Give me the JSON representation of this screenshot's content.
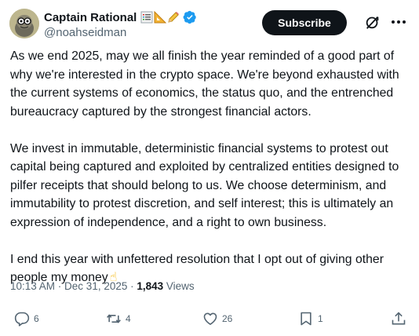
{
  "author": {
    "display_name": "Captain Rational",
    "handle": "@noahseidman",
    "badges": [
      "chart-icon",
      "triangular-ruler-icon",
      "pencil-icon"
    ],
    "verified": true
  },
  "header": {
    "subscribe_label": "Subscribe",
    "grok_icon": "grok-icon",
    "more_icon": "more-icon"
  },
  "post": {
    "paragraphs": [
      "As we end 2025, may we all finish the year reminded of a good part of why we're interested in the crypto space. We're beyond exhausted with the current systems of economics, the status quo, and the entrenched bureaucracy captured by the strongest financial actors.",
      "We invest in immutable, deterministic financial systems to protest out capital being captured and exploited by centralized entities designed to pilfer receipts that should belong to us.  We choose determinism, and immutability to protest discretion, and self interest; this is ultimately an expression of independence, and a right to own business.",
      "I end this year with unfettered resolution that I opt out of giving other people my money"
    ],
    "trailing_emoji": "☝",
    "time": "10:13 AM",
    "separator": " · ",
    "date": "Dec 31, 2025",
    "views_count": "1,843",
    "views_label": " Views"
  },
  "actions": {
    "replies": "6",
    "reposts": "4",
    "likes": "26",
    "bookmarks": "1"
  },
  "colors": {
    "text": "#0f1419",
    "secondary": "#536471",
    "verified": "#1d9bf0",
    "subscribe_bg": "#0f1419"
  }
}
